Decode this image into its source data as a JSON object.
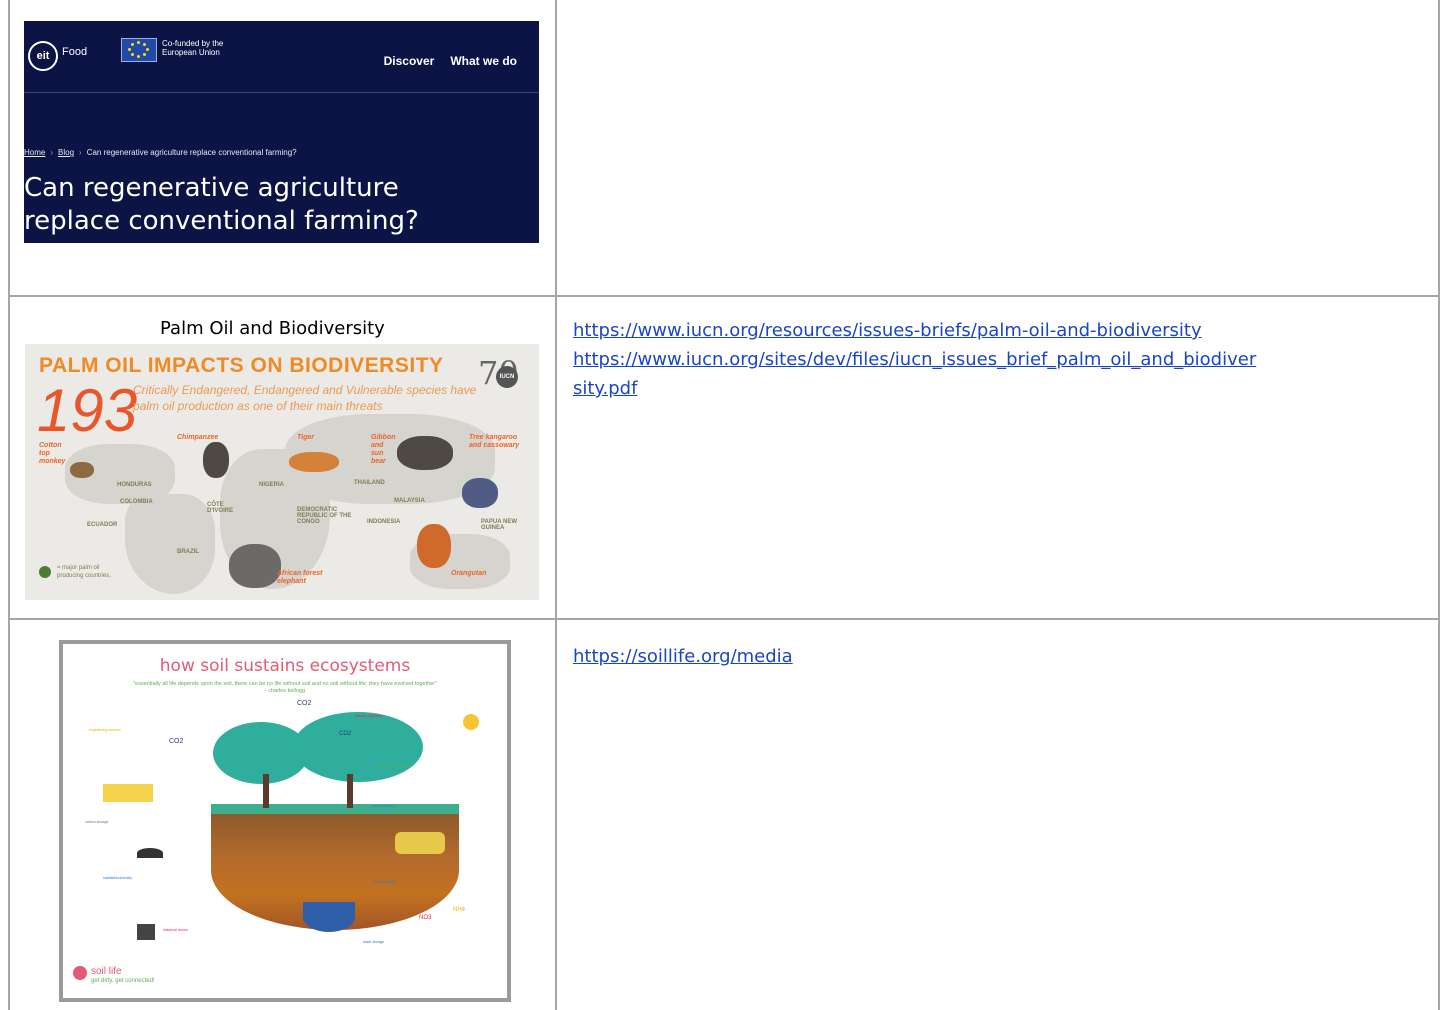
{
  "row1": {
    "eit": {
      "logo": "eit",
      "brand": "Food",
      "eu_text": "Co-funded by the European Union",
      "nav": [
        "Discover",
        "What we do"
      ],
      "breadcrumb": [
        "Home",
        "Blog",
        "Can regenerative agriculture replace conventional farming?"
      ],
      "breadcrumb_sep": "›",
      "title": "Can regenerative agriculture replace conventional farming?"
    }
  },
  "row2": {
    "caption": "Palm Oil and Biodiversity",
    "infographic": {
      "title": "PALM OIL IMPACTS ON BIODIVERSITY",
      "number": "193",
      "subtitle": "Critically Endangered, Endangered and Vulnerable species have palm oil production as one of their main threats",
      "badge": "70",
      "badge_org": "IUCN",
      "countries": [
        "HONDURAS",
        "COLOMBIA",
        "ECUADOR",
        "BRAZIL",
        "NIGERIA",
        "CÔTE D'IVOIRE",
        "DEMOCRATIC REPUBLIC OF THE CONGO",
        "THAILAND",
        "MALAYSIA",
        "INDONESIA",
        "PAPUA NEW GUINEA"
      ],
      "animals": [
        "Cotton top monkey",
        "Chimpanzee",
        "Tiger",
        "Gibbon and sun bear",
        "Tree kangaroo and cassowary",
        "African forest elephant",
        "Orangutan"
      ],
      "legend": "= major palm oil producing countries.",
      "colors": {
        "title": "#f08a24",
        "number": "#e8562a",
        "legend_dot": "#4f7d2f"
      }
    },
    "links": [
      "https://www.iucn.org/resources/issues-briefs/palm-oil-and-biodiversity",
      "https://www.iucn.org/sites/dev/files/iucn_issues_brief_palm_oil_and_biodiversity.pdf"
    ],
    "link2_lines": [
      "https://www.iucn.org/sites/dev/files/iucn_issues_brief_palm_oil_and_biodiver",
      "sity.pdf"
    ]
  },
  "row3": {
    "infographic": {
      "title": "how soil sustains ecosystems",
      "quote": "\"essentially all life depends upon the soil, there can be no life without soil and no soil without life; they have evolved together\" - charles kellogg",
      "brand": "soil life",
      "tagline": "get dirty. get connected!",
      "labels": [
        "engineering medium",
        "climate regulation",
        "medium for plant growth",
        "carbon storage",
        "water filtration",
        "habitat/biodiversity",
        "nutrient cycling",
        "historical record",
        "water storage"
      ],
      "chem": [
        "CO2",
        "CO2",
        "CO2",
        "NO3",
        "NH4"
      ]
    },
    "link": "https://soillife.org/media"
  }
}
